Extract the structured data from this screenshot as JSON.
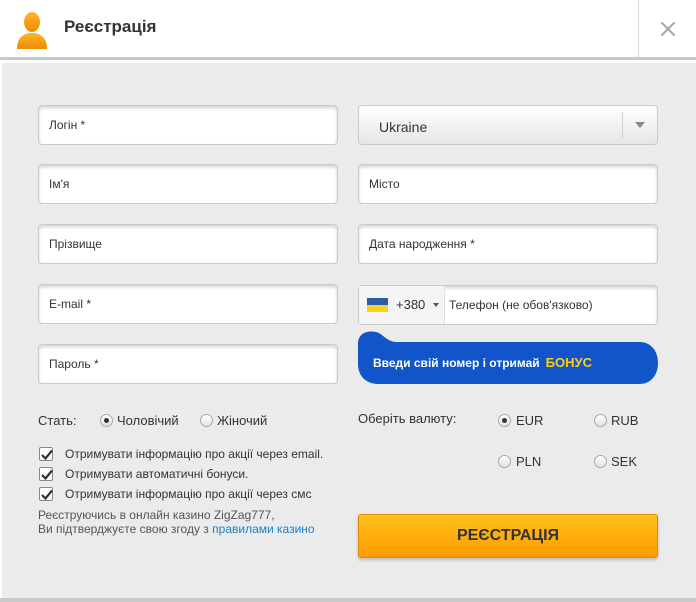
{
  "header": {
    "title": "Реєстрація",
    "avatar_icon": "user-icon",
    "close_icon": "close-icon"
  },
  "form": {
    "login_placeholder": "Логін *",
    "name_placeholder": "Ім'я",
    "surname_placeholder": "Прізвище",
    "email_placeholder": "E-mail *",
    "password_placeholder": "Пароль *",
    "country_value": "Ukraine",
    "city_placeholder": "Місто",
    "birthdate_placeholder": "Дата народження *",
    "phone_code": "+380",
    "phone_placeholder": "Телефон (не обов'язково)"
  },
  "bonus": {
    "text": "Введи свій номер і отримай",
    "highlight": "БОНУС"
  },
  "gender": {
    "label": "Стать:",
    "options": [
      "Чоловічий",
      "Жіночий"
    ],
    "selected": "Чоловічий"
  },
  "currency": {
    "label": "Оберіть валюту:",
    "options": [
      "EUR",
      "RUB",
      "PLN",
      "SEK"
    ],
    "selected": "EUR"
  },
  "checkboxes": [
    {
      "label": "Отримувати інформацію про акції через email.",
      "checked": true
    },
    {
      "label": "Отримувати автоматичні бонуси.",
      "checked": true
    },
    {
      "label": "Отримувати інформацію про акції через смс",
      "checked": true
    }
  ],
  "legal": {
    "line1": "Реєструючись в онлайн казино ZigZag777,",
    "line2_prefix": "Ви підтверджуєте свою згоду з",
    "link_text": "правилами казино"
  },
  "submit_label": "РЕЄСТРАЦІЯ",
  "colors": {
    "accent_orange": "#ff9a00",
    "bonus_blue": "#1155c8",
    "bonus_yellow": "#ffd200",
    "link_blue": "#1a7fc8"
  }
}
